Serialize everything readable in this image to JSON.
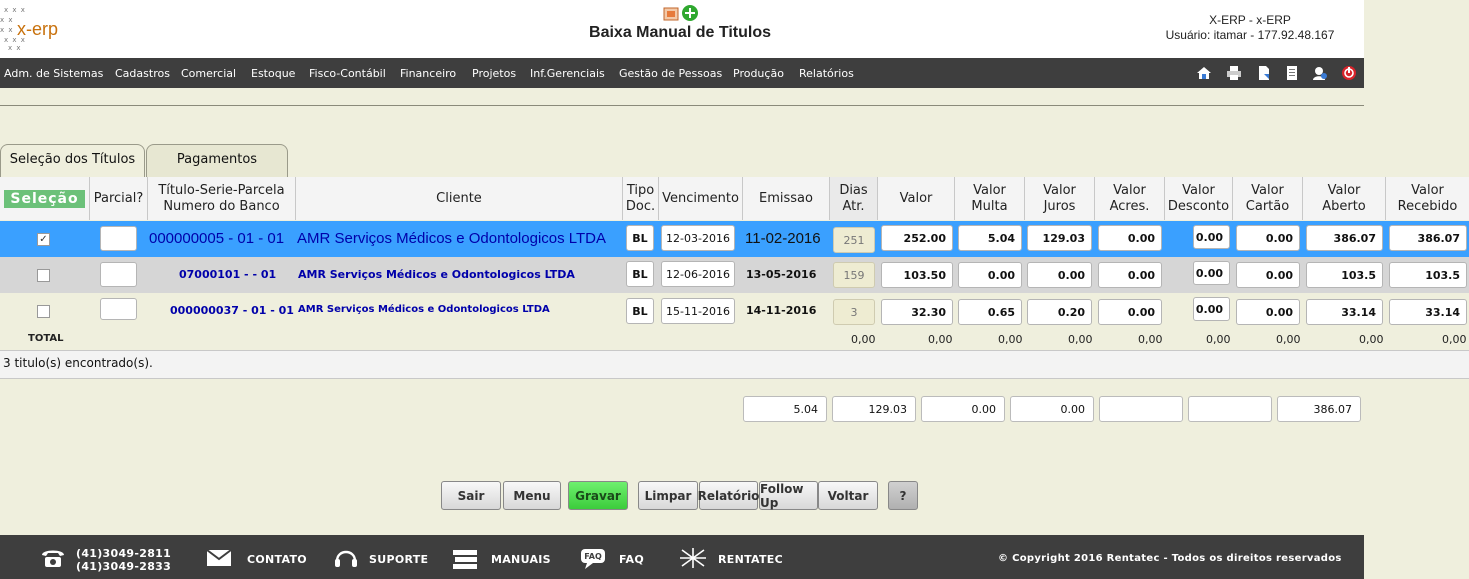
{
  "app": {
    "logo_text": "x-erp",
    "page_title": "Baixa Manual de Titulos",
    "system_name": "X-ERP - x-ERP",
    "user_info": "Usuário: itamar - 177.92.48.167"
  },
  "menu": {
    "items": [
      "Adm. de Sistemas",
      "Cadastros",
      "Comercial",
      "Estoque",
      "Fisco-Contábil",
      "Financeiro",
      "Projetos",
      "Inf.Gerenciais",
      "Gestão de Pessoas",
      "Produção",
      "Relatórios"
    ],
    "toolbar_icons": [
      "home-icon",
      "printer-icon",
      "document-icon",
      "page-icon",
      "user-refresh-icon",
      "power-icon"
    ]
  },
  "tabs": [
    {
      "label": "Seleção dos Títulos",
      "active": true
    },
    {
      "label": "Pagamentos",
      "active": false
    }
  ],
  "table": {
    "headers": {
      "selecao": "Seleção",
      "parcial": "Parcial?",
      "titulo_l1": "Título-Serie-Parcela",
      "titulo_l2": "Numero do Banco",
      "cliente": "Cliente",
      "tipo_l1": "Tipo",
      "tipo_l2": "Doc.",
      "vencimento": "Vencimento",
      "emissao": "Emissao",
      "dias_l1": "Dias",
      "dias_l2": "Atr.",
      "valor": "Valor",
      "multa_l1": "Valor",
      "multa_l2": "Multa",
      "juros_l1": "Valor",
      "juros_l2": "Juros",
      "acres_l1": "Valor",
      "acres_l2": "Acres.",
      "desc_l1": "Valor",
      "desc_l2": "Desconto",
      "cartao_l1": "Valor",
      "cartao_l2": "Cartão",
      "aberto_l1": "Valor",
      "aberto_l2": "Aberto",
      "receb_l1": "Valor",
      "receb_l2": "Recebido"
    },
    "rows": [
      {
        "selected": true,
        "titulo": "000000005 - 01 - 01",
        "cliente": "AMR Serviços Médicos e Odontologicos LTDA",
        "tipo": "BL",
        "vencimento": "12-03-2016",
        "emissao": "11-02-2016",
        "dias": "251",
        "valor": "252.00",
        "multa": "5.04",
        "juros": "129.03",
        "acres": "0.00",
        "desconto": "0.00",
        "cartao": "0.00",
        "aberto": "386.07",
        "recebido": "386.07"
      },
      {
        "selected": false,
        "titulo": "07000101 - - 01",
        "cliente": "AMR Serviços Médicos e Odontologicos LTDA",
        "tipo": "BL",
        "vencimento": "12-06-2016",
        "emissao": "13-05-2016",
        "dias": "159",
        "valor": "103.50",
        "multa": "0.00",
        "juros": "0.00",
        "acres": "0.00",
        "desconto": "0.00",
        "cartao": "0.00",
        "aberto": "103.5",
        "recebido": "103.5"
      },
      {
        "selected": false,
        "titulo": "000000037 - 01 - 01",
        "cliente": "AMR Serviços Médicos e Odontologicos LTDA",
        "tipo": "BL",
        "vencimento": "15-11-2016",
        "emissao": "14-11-2016",
        "dias": "3",
        "valor": "32.30",
        "multa": "0.65",
        "juros": "0.20",
        "acres": "0.00",
        "desconto": "0.00",
        "cartao": "0.00",
        "aberto": "33.14",
        "recebido": "33.14"
      }
    ],
    "totals": {
      "label": "TOTAL",
      "dias": "0,00",
      "valor": "0,00",
      "multa": "0,00",
      "juros": "0,00",
      "acres": "0,00",
      "desconto": "0,00",
      "cartao": "0,00",
      "aberto": "0,00",
      "recebido": "0,00"
    },
    "found_text": "3 titulo(s) encontrado(s)."
  },
  "summary": {
    "multa": "5.04",
    "juros": "129.03",
    "acres": "0.00",
    "desconto": "0.00",
    "cartao": "",
    "outro": "",
    "total": "386.07"
  },
  "buttons": {
    "sair": "Sair",
    "menu": "Menu",
    "gravar": "Gravar",
    "limpar": "Limpar",
    "relatorio": "Relatório",
    "followup": "Follow Up",
    "voltar": "Voltar",
    "help": "?"
  },
  "footer": {
    "phone1": "(41)3049-2811",
    "phone2": "(41)3049-2833",
    "contato": "CONTATO",
    "suporte": "SUPORTE",
    "manuais": "MANUAIS",
    "faq": "FAQ",
    "rentatec": "RENTATEC",
    "copyright": "© Copyright 2016 Rentatec - Todos os direitos reservados"
  },
  "colors": {
    "page_bg": "#efefdd",
    "menubar_bg": "#3e3e3e",
    "selected_row": "#3aa0ff",
    "gravar_green": "#4cdc4c",
    "selecao_badge": "#6cc179",
    "link_blue": "#0000aa"
  }
}
